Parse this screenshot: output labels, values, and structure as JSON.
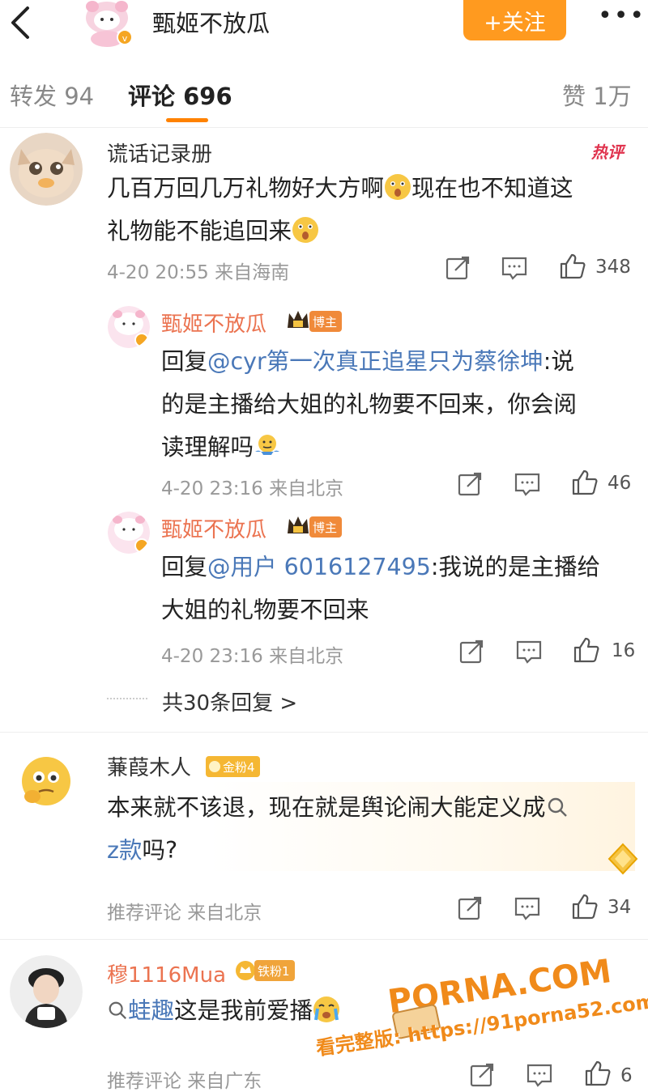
{
  "header": {
    "title": "甄姬不放瓜",
    "follow_label": "+关注",
    "more_label": "•••"
  },
  "tabs": [
    {
      "label": "转发",
      "count": "94"
    },
    {
      "label": "评论",
      "count": "696"
    },
    {
      "label": "赞",
      "count": "1万"
    }
  ],
  "hot_tag": "热评",
  "comments": [
    {
      "name": "谎话记录册",
      "text_line1": "几百万回几万礼物好大方啊",
      "text_line1b": "现在也不知道这",
      "text_line2": "礼物能不能追回来",
      "meta": "4-20 20:55 来自海南",
      "likes": "348",
      "replies": [
        {
          "name": "甄姬不放瓜",
          "badge": "博主",
          "prefix": "回复",
          "mention": "@cyr第一次真正追星只为蔡徐坤",
          "text_a": ":说",
          "text_line2": "的是主播给大姐的礼物要不回来，你会阅",
          "text_line3": "读理解吗",
          "meta": "4-20 23:16 来自北京",
          "likes": "46"
        },
        {
          "name": "甄姬不放瓜",
          "badge": "博主",
          "prefix": "回复",
          "mention": "@用户 6016127495",
          "text_a": ":我说的是主播给",
          "text_line2": "大姐的礼物要不回来",
          "meta": "4-20 23:16 来自北京",
          "likes": "16"
        }
      ],
      "more_replies": "共30条回复 >"
    },
    {
      "name": "蒹葭木人",
      "badge": "金粉4",
      "text_line1": "本来就不该退，现在就是舆论闹大能定义成",
      "text_line2_link": "z款",
      "text_line2": "吗?",
      "meta": "推荐评论 来自北京",
      "likes": "34"
    },
    {
      "name": "穆1116Mua",
      "badge": "铁粉1",
      "text_link": "蛙趣",
      "text": "这是我前爱播",
      "meta": "推荐评论 来自广东",
      "likes": "6"
    }
  ],
  "watermark": {
    "site": "PORNA.COM",
    "line2": "看完整版: https://91porna52.com"
  },
  "colors": {
    "accent": "#ff9a1f",
    "link": "#4a78b8",
    "reply_name": "#eb7350",
    "hot": "#e0334e"
  }
}
